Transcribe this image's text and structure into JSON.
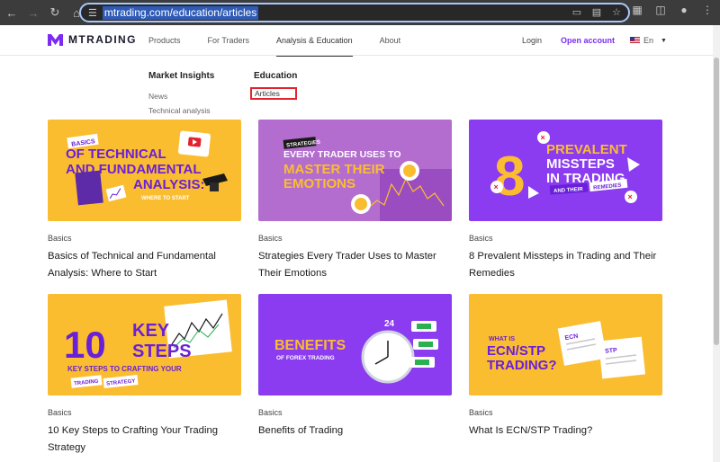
{
  "browser": {
    "url": "mtrading.com/education/articles"
  },
  "header": {
    "brand": "MTRADING",
    "nav": [
      "Products",
      "For Traders",
      "Analysis & Education",
      "About"
    ],
    "login": "Login",
    "open_account": "Open account",
    "language": "En"
  },
  "menu": {
    "market_insights": {
      "heading": "Market Insights",
      "links": [
        "News",
        "Technical analysis"
      ]
    },
    "education": {
      "heading": "Education",
      "links": [
        "Articles"
      ]
    }
  },
  "articles": [
    {
      "category": "Basics",
      "title": "Basics of Technical and Fundamental Analysis: Where to Start",
      "thumb_tag": "BASICS",
      "thumb_line1": "OF TECHNICAL",
      "thumb_line2": "AND FUNDAMENTAL",
      "thumb_line3": "ANALYSIS:",
      "thumb_line4": "WHERE TO START",
      "bg": "#fbbd30"
    },
    {
      "category": "Basics",
      "title": "Strategies Every Trader Uses to Master Their Emotions",
      "thumb_tag": "STRATEGIES",
      "thumb_line1": "EVERY TRADER USES TO",
      "thumb_line2": "MASTER THEIR",
      "thumb_line3": "EMOTIONS",
      "bg": "#b36dce"
    },
    {
      "category": "Basics",
      "title": "8 Prevalent Missteps in Trading and Their Remedies",
      "thumb_num": "8",
      "thumb_line1": "PREVALENT",
      "thumb_line2": "MISSTEPS",
      "thumb_line3": "IN TRADING",
      "thumb_tag1": "AND THEIR",
      "thumb_tag2": "REMEDIES",
      "bg": "#8b3bf0"
    },
    {
      "category": "Basics",
      "title": "10 Key Steps to Crafting Your Trading Strategy",
      "thumb_num": "10",
      "thumb_line1": "KEY",
      "thumb_line2": "STEPS",
      "thumb_line3": "KEY STEPS TO CRAFTING YOUR",
      "thumb_tag1": "TRADING",
      "thumb_tag2": "STRATEGY",
      "bg": "#fbbd30"
    },
    {
      "category": "Basics",
      "title": "Benefits of Trading",
      "thumb_line1": "BENEFITS",
      "thumb_line2": "OF FOREX TRADING",
      "thumb_num": "24",
      "bg": "#8b3bf0"
    },
    {
      "category": "Basics",
      "title": "What Is ECN/STP Trading?",
      "thumb_line1": "WHAT IS",
      "thumb_line2": "ECN/STP",
      "thumb_line3": "TRADING?",
      "thumb_tag1": "ECN",
      "thumb_tag2": "STP",
      "bg": "#fbbd30"
    }
  ],
  "colors": {
    "brand_purple": "#7b2bf2",
    "highlight_red": "#e3222d",
    "yellow": "#fbbd30",
    "purple": "#8b3bf0",
    "text_purple": "#6a1fd8"
  }
}
